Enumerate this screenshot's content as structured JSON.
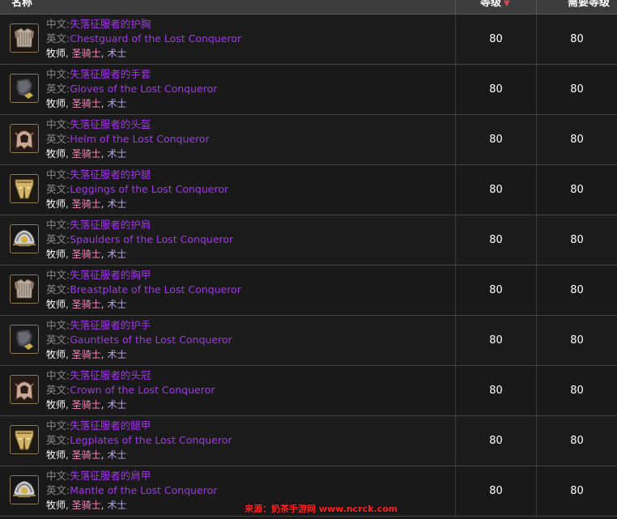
{
  "header": {
    "name_col": "名称",
    "level_col": "等级",
    "level_sort": "▼",
    "req_col": "需要等级"
  },
  "labels": {
    "zh": "中文:",
    "en": "英文:",
    "class_sep": ", "
  },
  "rows": [
    {
      "icon": "chest-armor-icon",
      "zh": "失落征服者的护胸",
      "en": "Chestguard of the Lost Conqueror",
      "classes": [
        "牧师",
        "圣骑士",
        "术士"
      ],
      "level": "80",
      "req": "80"
    },
    {
      "icon": "gloves-icon",
      "zh": "失落征服者的手套",
      "en": "Gloves of the Lost Conqueror",
      "classes": [
        "牧师",
        "圣骑士",
        "术士"
      ],
      "level": "80",
      "req": "80"
    },
    {
      "icon": "helm-icon",
      "zh": "失落征服者的头盔",
      "en": "Helm of the Lost Conqueror",
      "classes": [
        "牧师",
        "圣骑士",
        "术士"
      ],
      "level": "80",
      "req": "80"
    },
    {
      "icon": "leggings-icon",
      "zh": "失落征服者的护腿",
      "en": "Leggings of the Lost Conqueror",
      "classes": [
        "牧师",
        "圣骑士",
        "术士"
      ],
      "level": "80",
      "req": "80"
    },
    {
      "icon": "shoulder-icon",
      "zh": "失落征服者的护肩",
      "en": "Spaulders of the Lost Conqueror",
      "classes": [
        "牧师",
        "圣骑士",
        "术士"
      ],
      "level": "80",
      "req": "80"
    },
    {
      "icon": "chest-armor-icon",
      "zh": "失落征服者的胸甲",
      "en": "Breastplate of the Lost Conqueror",
      "classes": [
        "牧师",
        "圣骑士",
        "术士"
      ],
      "level": "80",
      "req": "80"
    },
    {
      "icon": "gloves-icon",
      "zh": "失落征服者的护手",
      "en": "Gauntlets of the Lost Conqueror",
      "classes": [
        "牧师",
        "圣骑士",
        "术士"
      ],
      "level": "80",
      "req": "80"
    },
    {
      "icon": "helm-icon",
      "zh": "失落征服者的头冠",
      "en": "Crown of the Lost Conqueror",
      "classes": [
        "牧师",
        "圣骑士",
        "术士"
      ],
      "level": "80",
      "req": "80"
    },
    {
      "icon": "leggings-icon",
      "zh": "失落征服者的腿甲",
      "en": "Legplates of the Lost Conqueror",
      "classes": [
        "牧师",
        "圣骑士",
        "术士"
      ],
      "level": "80",
      "req": "80"
    },
    {
      "icon": "shoulder-icon",
      "zh": "失落征服者的肩甲",
      "en": "Mantle of the Lost Conqueror",
      "classes": [
        "牧师",
        "圣骑士",
        "术士"
      ],
      "level": "80",
      "req": "80"
    }
  ],
  "watermark": "来源：奶茶手游网 www.ncrck.com",
  "colors": {
    "epic": "#a335ee",
    "priest": "#ffffff",
    "paladin": "#f58cba",
    "warlock": "#b7a6de"
  }
}
